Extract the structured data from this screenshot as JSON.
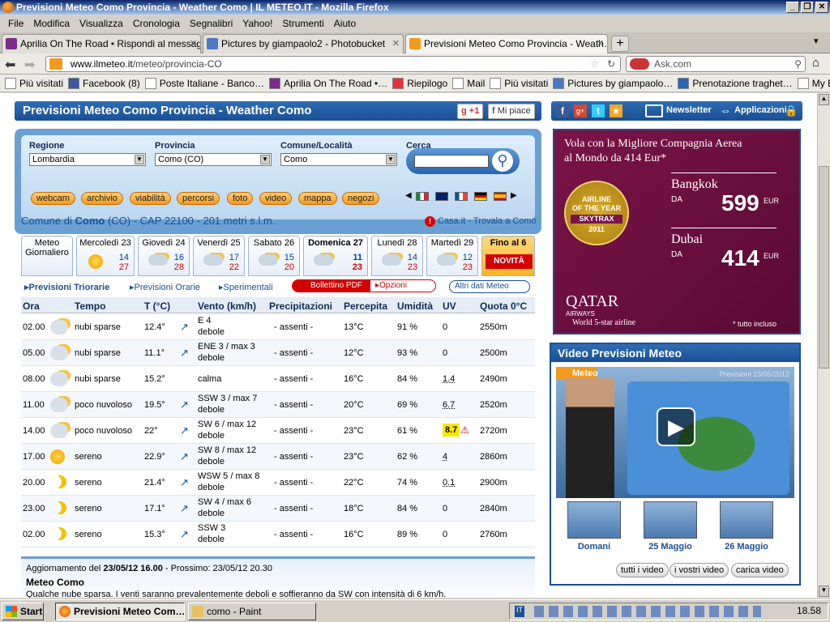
{
  "window": {
    "title": "Previsioni Meteo Como Provincia - Weather Como | IL METEO.IT - Mozilla Firefox"
  },
  "menu": [
    "File",
    "Modifica",
    "Visualizza",
    "Cronologia",
    "Segnalibri",
    "Yahoo!",
    "Strumenti",
    "Aiuto"
  ],
  "tabs": [
    {
      "label": "Aprilia On The Road • Rispondi al messag…",
      "active": false
    },
    {
      "label": "Pictures by giampaolo2 - Photobucket",
      "active": false
    },
    {
      "label": "Previsioni Meteo Como Provincia - Weath…",
      "active": true
    }
  ],
  "nav": {
    "url_host": "www.ilmeteo.it",
    "url_path": "/meteo/provincia-CO",
    "search_placeholder": "Ask.com"
  },
  "bookmarks": [
    "Più visitati",
    "Facebook (8)",
    "Poste Italiane - Banco…",
    "Aprilia On The Road •…",
    "Riepilogo",
    "Mail",
    "Più visitati",
    "Pictures by giampaolo…",
    "Prenotazione traghet…",
    "My Enel"
  ],
  "site": {
    "header_title": "Previsioni Meteo Como Provincia - Weather Como",
    "gplus": "+1",
    "like": "Mi piace",
    "newsletter": "Newsletter",
    "apps": "Applicazioni",
    "form": {
      "regione_label": "Regione",
      "regione_value": "Lombardia",
      "provincia_label": "Provincia",
      "provincia_value": "Como (CO)",
      "comune_label": "Comune/Località",
      "comune_value": "Como",
      "cerca_label": "Cerca"
    },
    "pills": [
      "webcam",
      "archivio",
      "viabilità",
      "percorsi",
      "foto",
      "video",
      "mappa",
      "negozi"
    ],
    "comune_line_pre": "Comune di ",
    "comune_name": "Como",
    "comune_line_post": " (CO) - CAP 22100 - 201 metri s.l.m.",
    "casa_link": "Casa.it - Trovala a Como",
    "days": [
      {
        "name": "Meteo Giornaliero",
        "min": "",
        "max": ""
      },
      {
        "name": "Mercoledì 23",
        "min": "14",
        "max": "27"
      },
      {
        "name": "Giovedì 24",
        "min": "16",
        "max": "28"
      },
      {
        "name": "Venerdì 25",
        "min": "17",
        "max": "22"
      },
      {
        "name": "Sabato 26",
        "min": "15",
        "max": "20"
      },
      {
        "name": "Domenica 27",
        "min": "11",
        "max": "23"
      },
      {
        "name": "Lunedì 28",
        "min": "14",
        "max": "23"
      },
      {
        "name": "Martedì 29",
        "min": "12",
        "max": "23"
      },
      {
        "name": "Fino al 6",
        "min": "",
        "max": "NOVITÀ"
      }
    ],
    "subnav": [
      "Previsioni Triorarie",
      "Previsioni Orarie",
      "Sperimentali"
    ],
    "bollettino": "Bollettino PDF",
    "opzioni": "Opzioni",
    "altri_dati": "Altri dati Meteo",
    "table_headers": [
      "Ora",
      "Tempo",
      "T (°C)",
      "Vento (km/h)",
      "Precipitazioni",
      "Percepita",
      "Umidità",
      "UV",
      "Quota 0°C"
    ],
    "rows": [
      {
        "ora": "02.00",
        "tempo": "nubi sparse",
        "t": "12.4°",
        "vento": "E 4",
        "vento2": "debole",
        "prec": "- assenti -",
        "perc": "13°C",
        "umid": "91 %",
        "uv": "0",
        "quota": "2550m"
      },
      {
        "ora": "05.00",
        "tempo": "nubi sparse",
        "t": "11.1°",
        "vento": "ENE 3 / max 3",
        "vento2": "debole",
        "prec": "- assenti -",
        "perc": "12°C",
        "umid": "93 %",
        "uv": "0",
        "quota": "2500m"
      },
      {
        "ora": "08.00",
        "tempo": "nubi sparse",
        "t": "15.2°",
        "vento": "calma",
        "vento2": "",
        "prec": "- assenti -",
        "perc": "16°C",
        "umid": "84 %",
        "uv": "1.4",
        "quota": "2490m"
      },
      {
        "ora": "11.00",
        "tempo": "poco nuvoloso",
        "t": "19.5°",
        "vento": "SSW 3 / max 7",
        "vento2": "debole",
        "prec": "- assenti -",
        "perc": "20°C",
        "umid": "69 %",
        "uv": "6.7",
        "quota": "2520m"
      },
      {
        "ora": "14.00",
        "tempo": "poco nuvoloso",
        "t": "22°",
        "vento": "SW 6 / max 12",
        "vento2": "debole",
        "prec": "- assenti -",
        "perc": "23°C",
        "umid": "61 %",
        "uv": "8.7",
        "quota": "2720m"
      },
      {
        "ora": "17.00",
        "tempo": "sereno",
        "t": "22.9°",
        "vento": "SW 8 / max 12",
        "vento2": "debole",
        "prec": "- assenti -",
        "perc": "23°C",
        "umid": "62 %",
        "uv": "4",
        "quota": "2860m"
      },
      {
        "ora": "20.00",
        "tempo": "sereno",
        "t": "21.4°",
        "vento": "WSW 5 / max 8",
        "vento2": "debole",
        "prec": "- assenti -",
        "perc": "22°C",
        "umid": "74 %",
        "uv": "0.1",
        "quota": "2900m"
      },
      {
        "ora": "23.00",
        "tempo": "sereno",
        "t": "17.1°",
        "vento": "SW 4 / max 6",
        "vento2": "debole",
        "prec": "- assenti -",
        "perc": "18°C",
        "umid": "84 %",
        "uv": "0",
        "quota": "2840m"
      },
      {
        "ora": "02.00",
        "tempo": "sereno",
        "t": "15.3°",
        "vento": "SSW 3",
        "vento2": "debole",
        "prec": "- assenti -",
        "perc": "16°C",
        "umid": "89 %",
        "uv": "0",
        "quota": "2760m"
      }
    ],
    "update_pre": "Aggiornamento del ",
    "update_bold": "23/05/12 16.00",
    "update_post": " - Prossimo: 23/05/12 20.30",
    "meteo_como": "Meteo Como",
    "summary": "Qualche nube sparsa. I venti saranno prevalentemente deboli e soffieranno da SW con intensità di 6 km/h."
  },
  "ad": {
    "line1": "Vola con la Migliore Compagnia Aerea",
    "line2": "al Mondo da 414 Eur*",
    "badge1": "AIRLINE",
    "badge2": "OF THE YEAR",
    "badge3": "SKYTRAX",
    "badge4": "2011",
    "dest1": "Bangkok",
    "da1": "DA",
    "price1": "599",
    "eur1": "EUR",
    "dest2": "Dubai",
    "da2": "DA",
    "price2": "414",
    "eur2": "EUR",
    "brand": "QATAR",
    "brand_sub": "AIRWAYS",
    "tagline": "World 5-star airline",
    "footnote": "* tutto incluso"
  },
  "video": {
    "title": "Video Previsioni Meteo",
    "logo": "Meteo",
    "date": "Previsioni 23/05/2012",
    "thumbs": [
      "Domani",
      "25 Maggio",
      "26 Maggio"
    ],
    "buttons": [
      "tutti i video",
      "i vostri video",
      "carica video"
    ]
  },
  "taskbar": {
    "start": "Start",
    "items": [
      "Previsioni Meteo Com…",
      "como - Paint"
    ],
    "clock": "18.58"
  },
  "colors": {
    "brand_blue": "#1a4f93",
    "accent_orange": "#f39a1c",
    "uv_warning": "#ffe800"
  }
}
